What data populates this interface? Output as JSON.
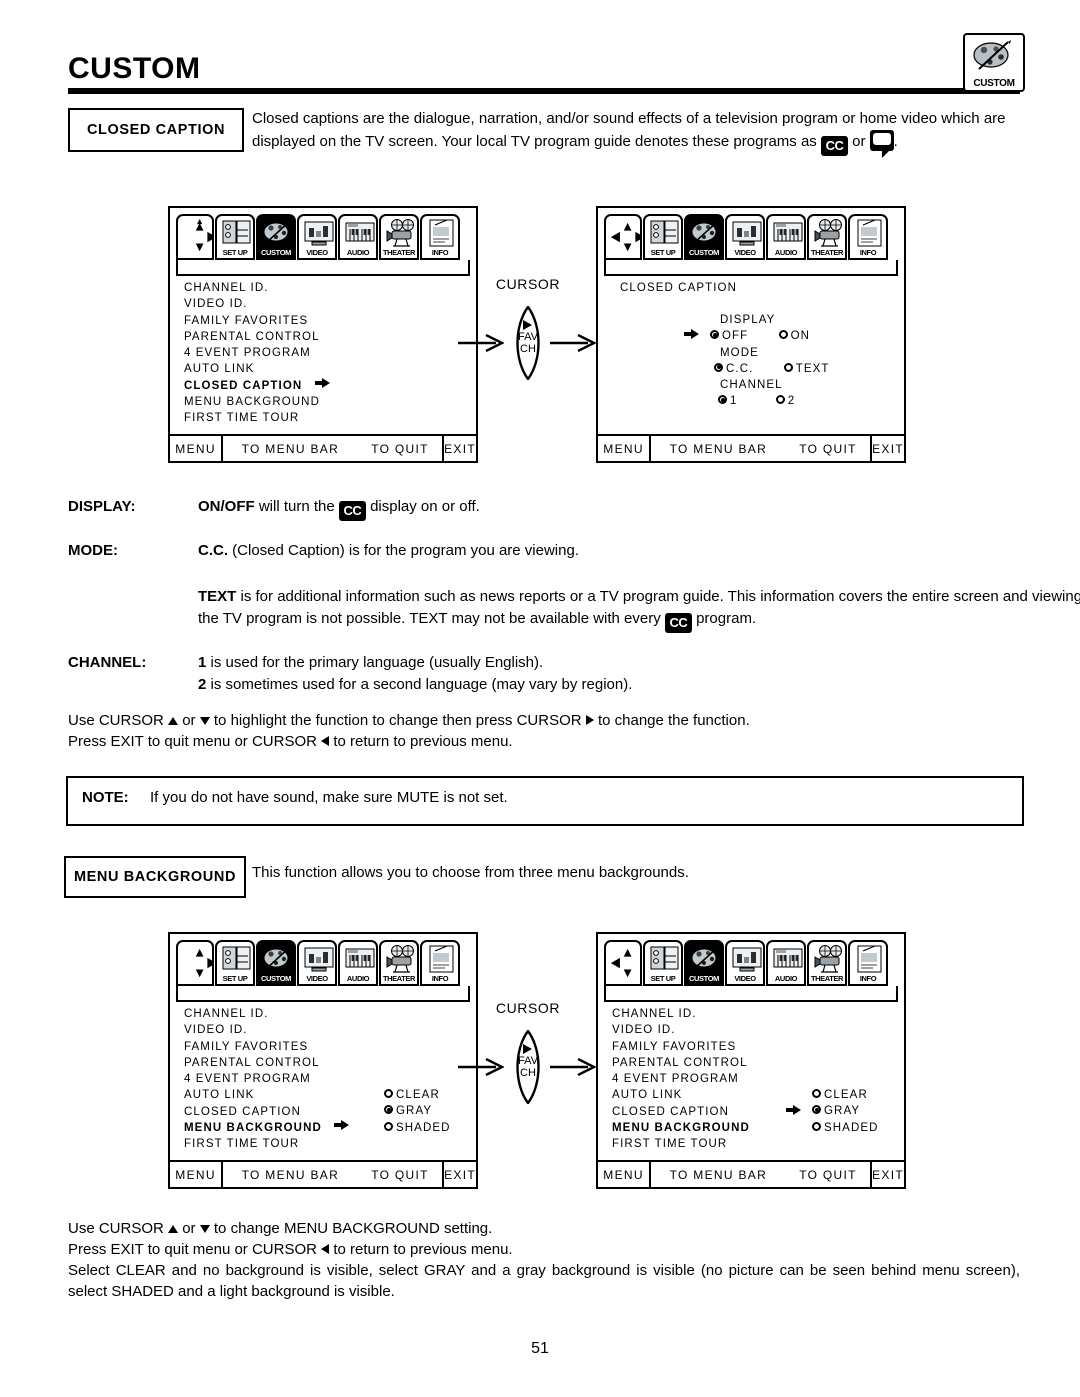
{
  "page": {
    "title": "CUSTOM",
    "badge_label": "CUSTOM",
    "page_number": "51"
  },
  "closed_caption": {
    "section_label": "CLOSED CAPTION",
    "intro_part1": "Closed captions are the dialogue, narration, and/or sound effects of a television program or home video which are displayed on the TV screen.  Your local TV program guide denotes these programs as",
    "cc_icon_text": "CC",
    "intro_or": "or",
    "intro_end": "."
  },
  "menu_bar": {
    "tabs": [
      {
        "label": "SET UP",
        "icon": "setup-icon"
      },
      {
        "label": "CUSTOM",
        "icon": "palette-icon"
      },
      {
        "label": "VIDEO",
        "icon": "video-icon"
      },
      {
        "label": "AUDIO",
        "icon": "audio-icon"
      },
      {
        "label": "THEATER",
        "icon": "theater-icon"
      },
      {
        "label": "INFO",
        "icon": "info-icon"
      }
    ],
    "selected": "CUSTOM"
  },
  "osd_footer": {
    "menu": "MENU",
    "to_menu_bar": "TO MENU BAR",
    "to_quit": "TO QUIT",
    "exit": "EXIT"
  },
  "custom_menu_items": [
    "CHANNEL ID.",
    "VIDEO ID.",
    "FAMILY FAVORITES",
    "PARENTAL CONTROL",
    "4 EVENT PROGRAM",
    "AUTO LINK",
    "CLOSED CAPTION",
    "MENU BACKGROUND",
    "FIRST TIME TOUR"
  ],
  "screen1": {
    "highlighted_item": "CLOSED CAPTION",
    "cursor_directions": "up-down-right"
  },
  "screen2": {
    "heading": "CLOSED CAPTION",
    "cursor_directions": "up-down-left-right",
    "groups": [
      {
        "name": "DISPLAY",
        "options": [
          {
            "label": "OFF",
            "selected": true
          },
          {
            "label": "ON",
            "selected": false
          }
        ],
        "pointer": true
      },
      {
        "name": "MODE",
        "options": [
          {
            "label": "C.C.",
            "selected": true
          },
          {
            "label": "TEXT",
            "selected": false
          }
        ],
        "pointer": false
      },
      {
        "name": "CHANNEL",
        "options": [
          {
            "label": "1",
            "selected": true
          },
          {
            "label": "2",
            "selected": false
          }
        ],
        "pointer": false
      }
    ]
  },
  "screen3": {
    "highlighted_item": "MENU BACKGROUND",
    "cursor_directions": "up-down-right",
    "options": [
      {
        "label": "CLEAR",
        "selected": false
      },
      {
        "label": "GRAY",
        "selected": true
      },
      {
        "label": "SHADED",
        "selected": false
      }
    ],
    "pointer_on": null
  },
  "screen4": {
    "highlighted_item": "MENU BACKGROUND",
    "cursor_directions": "up-down-left",
    "options": [
      {
        "label": "CLEAR",
        "selected": false
      },
      {
        "label": "GRAY",
        "selected": true
      },
      {
        "label": "SHADED",
        "selected": false
      }
    ],
    "pointer_on": "GRAY"
  },
  "connector": {
    "label": "CURSOR",
    "fav": "FAV",
    "ch": "CH"
  },
  "definitions": {
    "display_term": "DISPLAY:",
    "display_pre": "ON/OFF",
    "display_mid": "will turn the",
    "display_post": "display on or off.",
    "mode_term": "MODE:",
    "mode_bold": "C.C.",
    "mode_rest": "(Closed Caption) is for the program you are viewing.",
    "text_bold": "TEXT",
    "text_rest1": "is for additional information such as news reports or a TV program guide.  This information covers the entire screen and viewing the TV program is not possible.  TEXT may not be available with every",
    "text_rest2": "program.",
    "channel_term": "CHANNEL:",
    "channel_1_bold": "1",
    "channel_1_rest": "is used for the primary language (usually English).",
    "channel_2_bold": "2",
    "channel_2_rest": "is sometimes used for a second language (may vary by region)."
  },
  "cursor_help_1": {
    "line1_a": "Use CURSOR",
    "line1_b": "or",
    "line1_c": "to highlight the function to change then press CURSOR",
    "line1_d": "to change the function.",
    "line2_a": "Press EXIT to quit menu or CURSOR",
    "line2_b": "to return to previous menu."
  },
  "note": {
    "label": "NOTE:",
    "text": "If you do not have sound, make sure MUTE is not set."
  },
  "menu_background": {
    "section_label": "MENU BACKGROUND",
    "intro": "This function allows you to choose from three menu backgrounds."
  },
  "cursor_help_2": {
    "line1_a": "Use CURSOR",
    "line1_b": "or",
    "line1_c": "to change MENU BACKGROUND setting.",
    "line2_a": "Press EXIT to quit menu or CURSOR",
    "line2_b": "to return to previous menu.",
    "line3": "Select CLEAR and no background is visible, select GRAY and a gray background is visible (no picture can be seen behind menu screen), select SHADED and a light background is visible."
  }
}
